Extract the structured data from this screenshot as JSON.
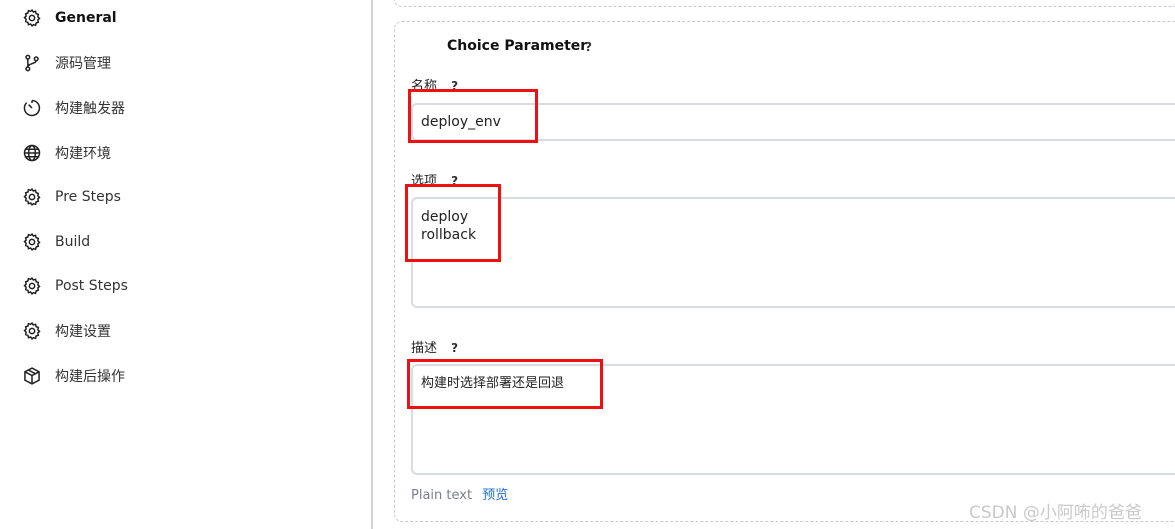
{
  "sidebar": {
    "items": [
      {
        "label": "General",
        "icon": "gear-icon",
        "active": true
      },
      {
        "label": "源码管理",
        "icon": "branch-icon"
      },
      {
        "label": "构建触发器",
        "icon": "timer-icon"
      },
      {
        "label": "构建环境",
        "icon": "globe-icon"
      },
      {
        "label": "Pre Steps",
        "icon": "gear-icon"
      },
      {
        "label": "Build",
        "icon": "gear-icon"
      },
      {
        "label": "Post Steps",
        "icon": "gear-icon"
      },
      {
        "label": "构建设置",
        "icon": "gear-icon"
      },
      {
        "label": "构建后操作",
        "icon": "package-icon"
      }
    ]
  },
  "param": {
    "title": "Choice Parameter",
    "help": "?",
    "name_label": "名称",
    "name_value": "deploy_env",
    "choices_label": "选项",
    "choices_value": "deploy\nrollback",
    "desc_label": "描述",
    "desc_value": "构建时选择部署还是回退",
    "plain_text": "Plain text",
    "preview": "预览"
  },
  "highlight_color": "#ee1111",
  "accent_color": "#1c6fd6",
  "watermark": "CSDN @小阿咘的爸爸"
}
